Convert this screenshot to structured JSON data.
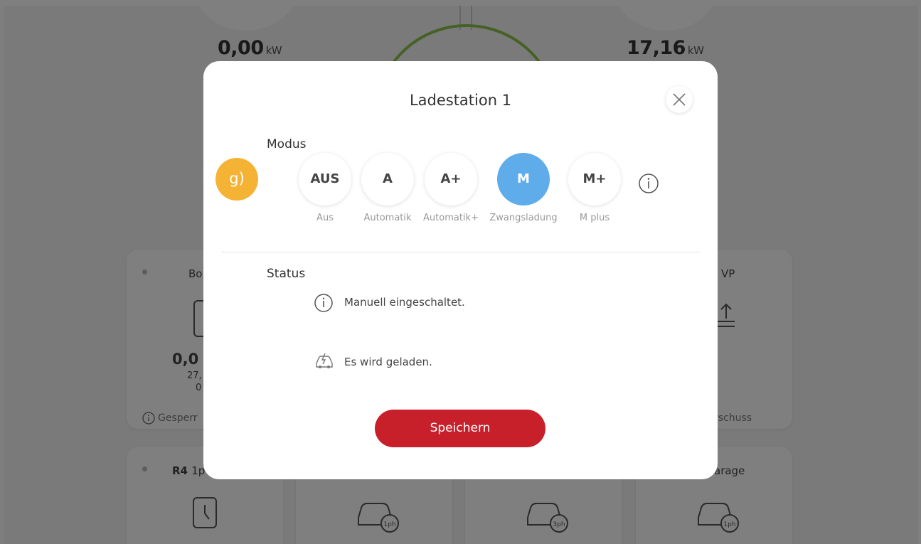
{
  "background": {
    "left_power_value": "0,00",
    "left_power_unit": "kW",
    "right_power_value": "17,16",
    "right_power_unit": "kW",
    "card_boiler_title": "Bo",
    "card_boiler_value": "0,0",
    "card_boiler_sub1": "27,",
    "card_boiler_sub2": "0",
    "card_boiler_status": "Gesperr",
    "card_wp_title": "VP",
    "card_wp_status": "rschuss",
    "card_r4_title": "R4",
    "card_r4_subtitle": "1p",
    "card_garage_title": "arage",
    "badge_1ph_a": "1ph",
    "badge_3ph": "3ph",
    "badge_1ph_b": "1ph"
  },
  "modal": {
    "title": "Ladestation 1",
    "section_mode": "Modus",
    "step_badge": "g)",
    "modes": [
      {
        "short": "AUS",
        "label": "Aus"
      },
      {
        "short": "A",
        "label": "Automatik"
      },
      {
        "short": "A+",
        "label": "Automatik+"
      },
      {
        "short": "M",
        "label": "Zwangsladung",
        "active": true
      },
      {
        "short": "M+",
        "label": "M plus"
      }
    ],
    "section_status": "Status",
    "status_lines": [
      {
        "icon": "info-icon",
        "text": "Manuell eingeschaltet."
      },
      {
        "icon": "car-charging-icon",
        "text": "Es wird geladen."
      }
    ],
    "save_label": "Speichern"
  },
  "colors": {
    "accent_blue": "#5eadea",
    "save_red": "#c8202b",
    "badge_orange": "#f5b335",
    "arc_green": "#8cc34a"
  }
}
